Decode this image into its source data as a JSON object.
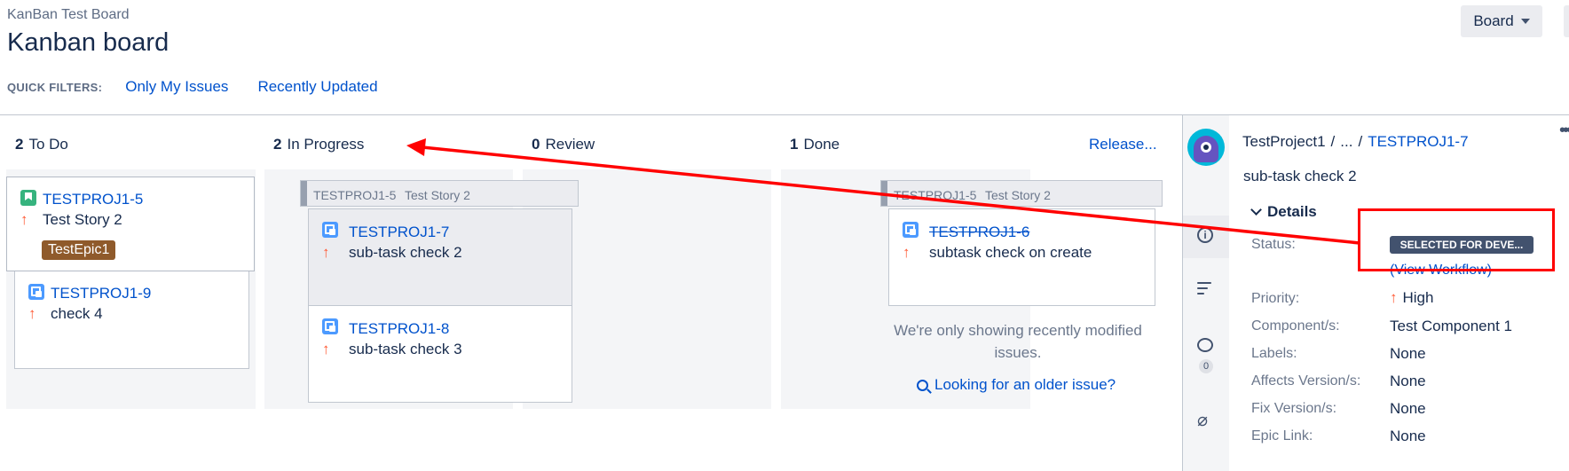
{
  "header": {
    "board_name": "KanBan Test Board",
    "title": "Kanban board",
    "board_button": "Board",
    "quick_filters_label": "QUICK FILTERS:",
    "quick_filters": [
      "Only My Issues",
      "Recently Updated"
    ]
  },
  "columns": [
    {
      "count": "2",
      "name": "To Do"
    },
    {
      "count": "2",
      "name": "In Progress"
    },
    {
      "count": "0",
      "name": "Review"
    },
    {
      "count": "1",
      "name": "Done",
      "action": "Release..."
    }
  ],
  "todo_cards": [
    {
      "key": "TESTPROJ1-5",
      "summary": "Test Story 2",
      "epic": "TestEpic1",
      "type_icon": "story-icon",
      "priority_icon": "arrow-up-icon"
    },
    {
      "key": "TESTPROJ1-9",
      "summary": "check 4",
      "type_icon": "subtask-icon",
      "priority_icon": "arrow-up-icon"
    }
  ],
  "swimlanes": {
    "in_progress": {
      "parent_key": "TESTPROJ1-5",
      "parent_summary": "Test Story 2"
    },
    "done": {
      "parent_key": "TESTPROJ1-5",
      "parent_summary": "Test Story 2"
    }
  },
  "in_progress_cards": [
    {
      "key": "TESTPROJ1-7",
      "summary": "sub-task check 2",
      "type_icon": "subtask-icon",
      "priority_icon": "arrow-up-icon"
    },
    {
      "key": "TESTPROJ1-8",
      "summary": "sub-task check 3",
      "type_icon": "subtask-icon",
      "priority_icon": "arrow-up-icon"
    }
  ],
  "done_cards": [
    {
      "key": "TESTPROJ1-6",
      "summary": "subtask check on create",
      "type_icon": "subtask-icon",
      "priority_icon": "arrow-up-icon"
    }
  ],
  "done_notice": "We're only showing recently modified issues.",
  "older_issue_link": "Looking for an older issue?",
  "detail": {
    "project": "TestProject1",
    "ellipsis": "...",
    "issue_key": "TESTPROJ1-7",
    "summary": "sub-task check 2",
    "section": "Details",
    "comment_count": "0",
    "fields": {
      "status_label": "Status:",
      "status_value": "SELECTED FOR DEVE...",
      "view_workflow": "(View Workflow)",
      "priority_label": "Priority:",
      "priority_value": "High",
      "component_label": "Component/s:",
      "component_value": "Test Component 1",
      "labels_label": "Labels:",
      "labels_value": "None",
      "affects_label": "Affects Version/s:",
      "affects_value": "None",
      "fix_label": "Fix Version/s:",
      "fix_value": "None",
      "epic_label": "Epic Link:",
      "epic_value": "None"
    }
  },
  "colors": {
    "link": "#0052cc",
    "annotation": "#ff0000",
    "epic": "#8f5a2b",
    "status": "#42526e",
    "priority": "#ff5630"
  }
}
